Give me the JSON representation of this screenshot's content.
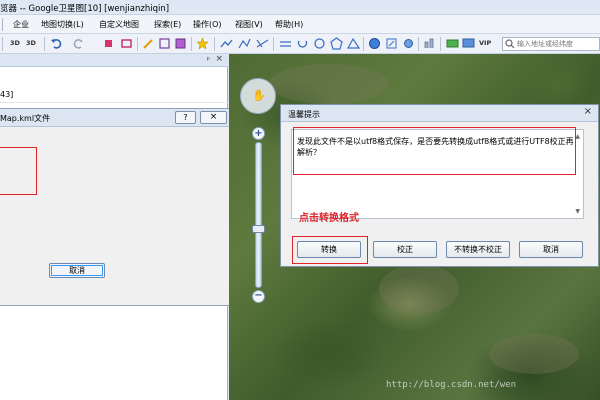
{
  "app": {
    "title": "览器 -- Google卫星图[10] [wenjianzhiqin]"
  },
  "menu": {
    "items": [
      "企业",
      "地图切换(L)",
      "自定义地图",
      "探索(E)",
      "操作(O)",
      "视图(V)",
      "帮助(H)"
    ]
  },
  "toolbar": {
    "label_3d_a": "3D",
    "label_3d_b": "3D",
    "label_vip": "VIP",
    "search_placeholder": "输入地址或经纬度",
    "icons": [
      "3d-view-icon",
      "3d-switch-icon",
      "undo-icon",
      "redo-icon",
      "stop-icon",
      "pen-icon",
      "cut-icon",
      "screenshot-icon",
      "star-icon",
      "line-icon",
      "polyline-icon",
      "path-icon",
      "circle-icon",
      "polygon-icon",
      "globe-icon",
      "edit-icon",
      "settings-icon",
      "chart-icon",
      "layer-icon",
      "color-icon",
      "vip-icon",
      "search-icon"
    ]
  },
  "left_panel": {
    "pin": "ᵖ",
    "close": "×",
    "row_text": "43]"
  },
  "left_dialog": {
    "caption": "Map.kml文件",
    "help": "?",
    "close": "×",
    "cancel": "取消"
  },
  "map_nav": {
    "zoom_in": "+",
    "zoom_out": "−",
    "zoom_level": 0.4
  },
  "right_dialog": {
    "caption": "温馨提示",
    "close": "×",
    "message": "发现此文件不是以utf8格式保存，是否要先转换成utf8格式或进行UTF8校正再解析？",
    "hint": "点击转换格式",
    "buttons": {
      "convert": "转换",
      "correct": "校正",
      "no_convert": "不转换不校正",
      "cancel": "取消"
    }
  },
  "watermark": "http://blog.csdn.net/wen",
  "colors": {
    "annotation_red": "#e0242a",
    "title_bg": "#dfe9f5",
    "dialog_bg": "#f0f0f0"
  }
}
